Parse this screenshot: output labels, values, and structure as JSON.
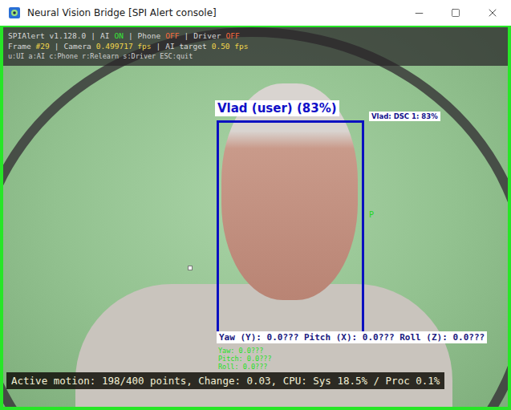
{
  "window": {
    "title": "Neural Vision Bridge [SPI Alert console]"
  },
  "hud": {
    "app": "SPIAlert v1.128.0",
    "separator": "|",
    "toggles": [
      {
        "label": "AI",
        "value": "ON",
        "on": true
      },
      {
        "label": "Phone",
        "value": "OFF",
        "on": false
      },
      {
        "label": "Driver",
        "value": "OFF",
        "on": false
      }
    ],
    "stats": [
      {
        "label": "Frame",
        "value": "#29"
      },
      {
        "label": "Camera",
        "value": "0.499717 fps"
      },
      {
        "label": "AI target",
        "value": "0.50 fps"
      }
    ],
    "keys": "u:UI a:AI c:Phone r:Relearn s:Driver ESC:quit"
  },
  "face": {
    "label": "Vlad (user) (83%)",
    "side_label": "Vlad: DSC 1: 83%",
    "landmark": "P",
    "pose": "Yaw (Y): 0.0??? Pitch (X): 0.0??? Roll (Z): 0.0???",
    "pose_lines": [
      "Yaw: 0.0???",
      "Pitch: 0.0???",
      "Roll: 0.0???"
    ]
  },
  "status_bar": "Active motion: 198/400 points, Change: 0.03, CPU: Sys 18.5% / Proc 0.1%"
}
